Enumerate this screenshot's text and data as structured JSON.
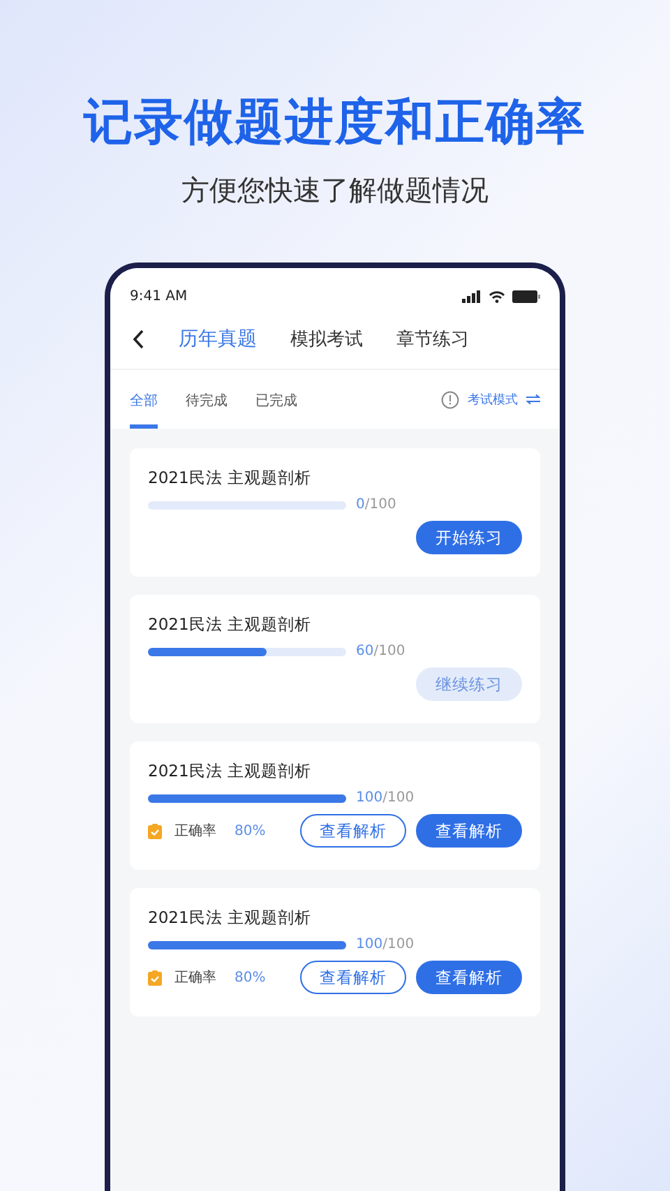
{
  "headline": "记录做题进度和正确率",
  "subtitle": "方便您快速了解做题情况",
  "status_bar": {
    "time": "9:41 AM"
  },
  "tabs": [
    {
      "label": "历年真题",
      "selected": true
    },
    {
      "label": "模拟考试",
      "selected": false
    },
    {
      "label": "章节练习",
      "selected": false
    }
  ],
  "filters": [
    {
      "label": "全部",
      "selected": true
    },
    {
      "label": "待完成",
      "selected": false
    },
    {
      "label": "已完成",
      "selected": false
    }
  ],
  "mode": {
    "label": "考试模式"
  },
  "cards": [
    {
      "title": "2021民法  主观题剖析",
      "level": 0,
      "done": "0",
      "total": "/100",
      "buttons": [
        {
          "label": "开始练习",
          "kind": "primary"
        }
      ]
    },
    {
      "title": "2021民法  主观题剖析",
      "level": 0.6,
      "done": "60",
      "total": "/100",
      "buttons": [
        {
          "label": "继续练习",
          "kind": "light"
        }
      ]
    },
    {
      "title": "2021民法  主观题剖析",
      "level": 1,
      "done": "100",
      "total": "/100",
      "accuracy_label": "正确率",
      "accuracy": "80%",
      "buttons": [
        {
          "label": "查看解析",
          "kind": "outline"
        },
        {
          "label": "查看解析",
          "kind": "primary"
        }
      ]
    },
    {
      "title": "2021民法  主观题剖析",
      "level": 1,
      "done": "100",
      "total": "/100",
      "accuracy_label": "正确率",
      "accuracy": "80%",
      "buttons": [
        {
          "label": "查看解析",
          "kind": "outline"
        },
        {
          "label": "查看解析",
          "kind": "primary"
        }
      ]
    }
  ]
}
